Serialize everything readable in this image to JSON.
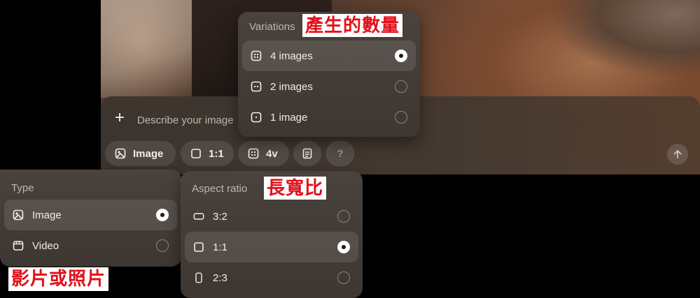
{
  "prompt": {
    "placeholder": "Describe your image",
    "add_icon": "plus-icon",
    "send_icon": "arrow-up-icon"
  },
  "toolbar": {
    "type_label": "Image",
    "aspect_label": "1:1",
    "variations_label": "4v",
    "help_label": "?"
  },
  "variations_popover": {
    "title": "Variations",
    "options": [
      {
        "label": "4 images",
        "selected": true
      },
      {
        "label": "2 images",
        "selected": false
      },
      {
        "label": "1 image",
        "selected": false
      }
    ]
  },
  "type_popover": {
    "title": "Type",
    "options": [
      {
        "label": "Image",
        "selected": true
      },
      {
        "label": "Video",
        "selected": false
      }
    ]
  },
  "aspect_popover": {
    "title": "Aspect ratio",
    "options": [
      {
        "label": "3:2",
        "selected": false
      },
      {
        "label": "1:1",
        "selected": true
      },
      {
        "label": "2:3",
        "selected": false
      }
    ]
  },
  "annotations": {
    "variations_note": "產生的數量",
    "aspect_note": "長寬比",
    "type_note": "影片或照片"
  },
  "colors": {
    "annotation_red": "#e2101a",
    "panel_bg": "#3f3833"
  }
}
